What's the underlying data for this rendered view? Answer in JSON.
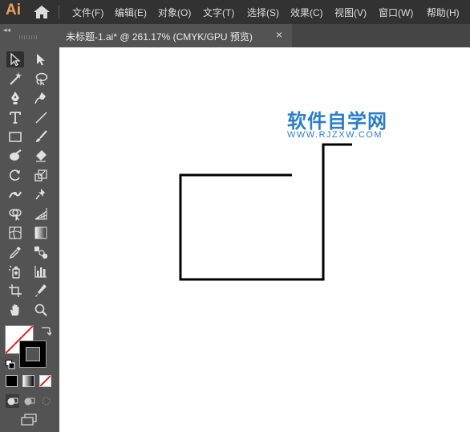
{
  "app": {
    "logo": "Ai"
  },
  "menu": {
    "items": [
      "文件(F)",
      "编辑(E)",
      "对象(O)",
      "文字(T)",
      "选择(S)",
      "效果(C)",
      "视图(V)",
      "窗口(W)",
      "帮助(H)"
    ]
  },
  "toolbar": {
    "collapse_label": "◂◂"
  },
  "document_tab": {
    "title": "未标题-1.ai* @ 261.17% (CMYK/GPU 预览)",
    "close_label": "×"
  },
  "watermark": {
    "line1": "软件自学网",
    "line2": "WWW.RJZXW.COM"
  },
  "colors": {
    "accent": "#e8a15b",
    "watermark": "#2a7ec8",
    "stroke": "#000000"
  }
}
